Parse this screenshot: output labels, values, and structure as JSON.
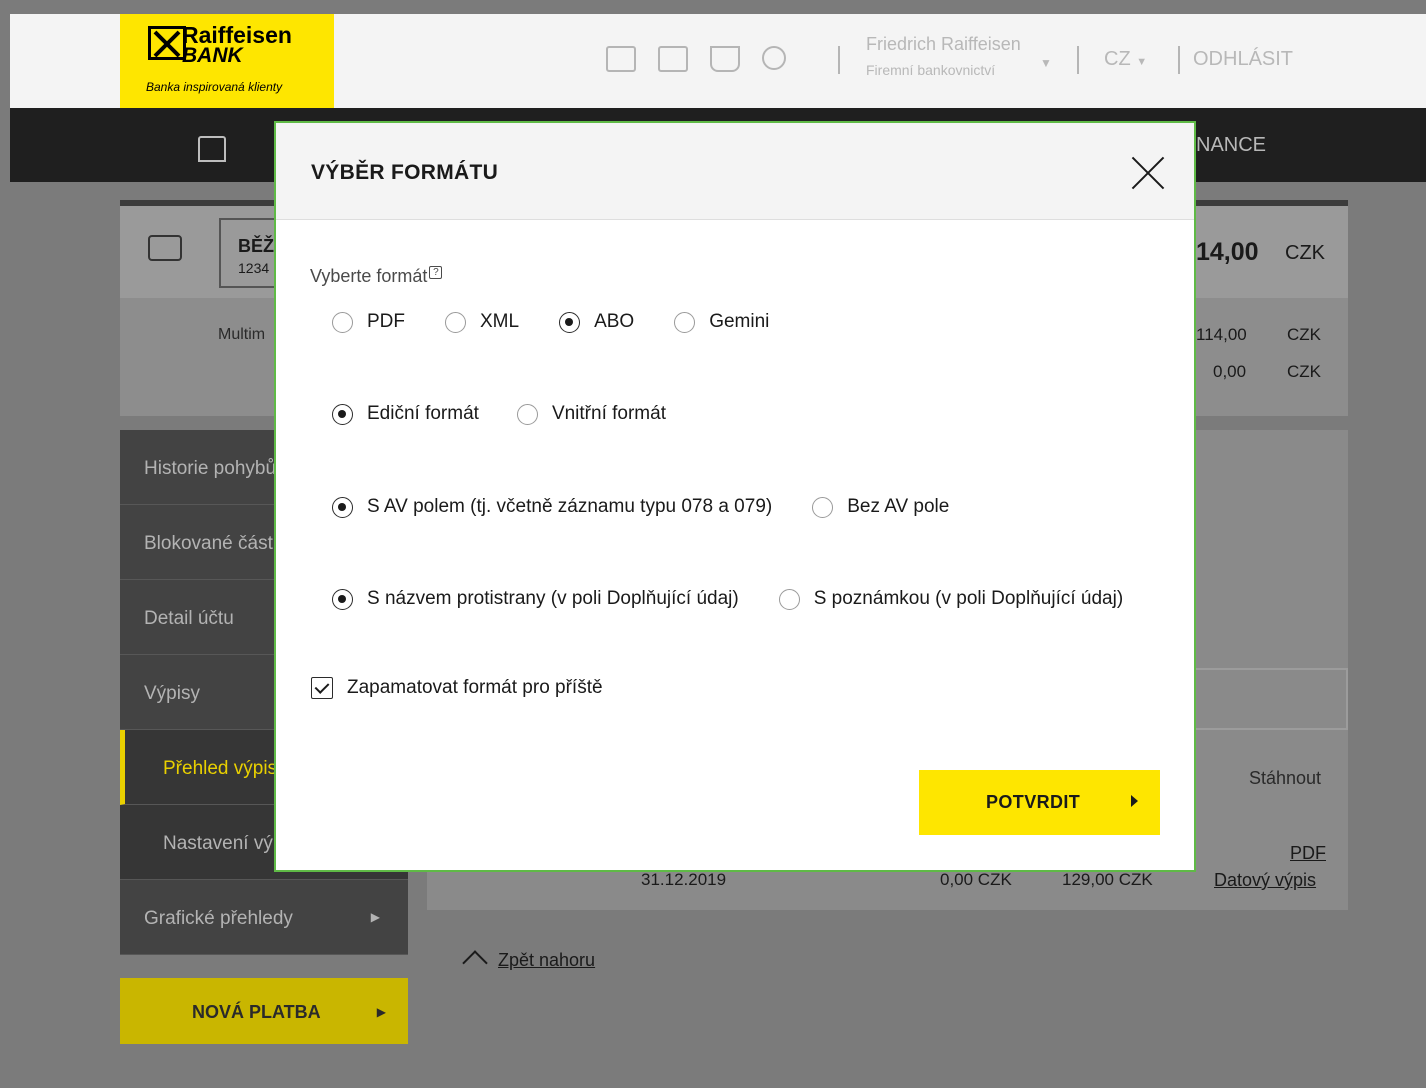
{
  "header": {
    "brand_line1": "Raiffeisen",
    "brand_line2": "BANK",
    "slogan": "Banka inspirovaná klienty",
    "icons": [
      "mail-icon",
      "download-folder-icon",
      "basket-icon",
      "gear-icon"
    ],
    "user_name": "Friedrich Raiffeisen",
    "user_sub": "Firemní bankovnictví",
    "language": "CZ",
    "logout": "ODHLÁSIT"
  },
  "nav": {
    "partial_item": "NANCE"
  },
  "account": {
    "name": "BĚŽ",
    "number": "1234",
    "multi_label": "Multim",
    "balance_main": "14,00",
    "currency": "CZK",
    "balance_1": "114,00",
    "balance_2": "0,00"
  },
  "sidebar": {
    "items": [
      {
        "label": "Historie pohybů"
      },
      {
        "label": "Blokované část"
      },
      {
        "label": "Detail účtu"
      },
      {
        "label": "Výpisy"
      },
      {
        "label": "Přehled výpis"
      },
      {
        "label": "Nastavení vý"
      },
      {
        "label": "Grafické přehledy"
      }
    ],
    "new_payment": "NOVÁ PLATBA"
  },
  "content": {
    "download_header": "Stáhnout",
    "row": {
      "date": "31.12.2019",
      "amount1": "0,00 CZK",
      "amount2": "129,00 CZK",
      "link_pdf": "PDF",
      "link_data": "Datový výpis"
    },
    "back_to_top": "Zpět nahoru"
  },
  "modal": {
    "title": "VÝBĚR FORMÁTU",
    "format_label": "Vyberte formát",
    "help_icon": "?",
    "formats": [
      {
        "label": "PDF",
        "checked": false
      },
      {
        "label": "XML",
        "checked": false
      },
      {
        "label": "ABO",
        "checked": true
      },
      {
        "label": "Gemini",
        "checked": false
      }
    ],
    "edition": [
      {
        "label": "Ediční formát",
        "checked": true
      },
      {
        "label": "Vnitřní formát",
        "checked": false
      }
    ],
    "av_field": [
      {
        "label": "S AV polem (tj. včetně záznamu typu 078 a 079)",
        "checked": true
      },
      {
        "label": "Bez AV pole",
        "checked": false
      }
    ],
    "counterparty": [
      {
        "label": "S názvem protistrany (v poli Doplňující údaj)",
        "checked": true
      },
      {
        "label": "S poznámkou (v poli Doplňující údaj)",
        "checked": false
      }
    ],
    "remember_label": "Zapamatovat formát pro příště",
    "remember_checked": true,
    "confirm_label": "POTVRDIT"
  },
  "colors": {
    "brand_yellow": "#fee600",
    "modal_border": "#5fba46"
  }
}
